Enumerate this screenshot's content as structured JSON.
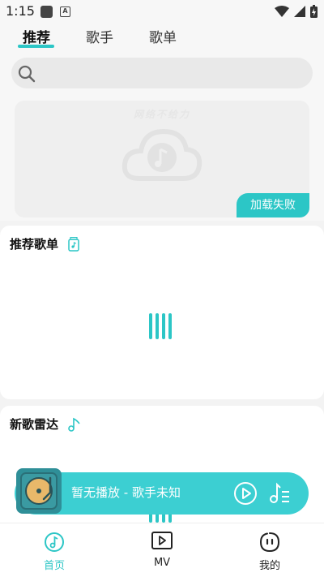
{
  "status_bar": {
    "time": "1:15",
    "app_icons": [
      "notification-app-icon",
      "a-app-icon"
    ],
    "system_icons": [
      "wifi-icon",
      "signal-icon",
      "battery-charging-icon"
    ]
  },
  "tabs": [
    {
      "label": "推荐",
      "active": true
    },
    {
      "label": "歌手",
      "active": false
    },
    {
      "label": "歌单",
      "active": false
    }
  ],
  "search": {
    "placeholder": ""
  },
  "banner": {
    "error_text": "网络不给力",
    "retry_label": "加载失败"
  },
  "sections": [
    {
      "title": "推荐歌单",
      "icon": "playlist-icon"
    },
    {
      "title": "新歌雷达",
      "icon": "music-note-icon"
    }
  ],
  "player": {
    "text": "暂无播放 - 歌手未知"
  },
  "bottom_nav": [
    {
      "label": "首页",
      "icon": "home-music-icon",
      "active": true
    },
    {
      "label": "MV",
      "icon": "mv-play-icon",
      "active": false
    },
    {
      "label": "我的",
      "icon": "profile-face-icon",
      "active": false
    }
  ],
  "colors": {
    "accent": "#2cc6c6",
    "player_bg": "#3ccfd2",
    "background": "#f3f3f3"
  }
}
